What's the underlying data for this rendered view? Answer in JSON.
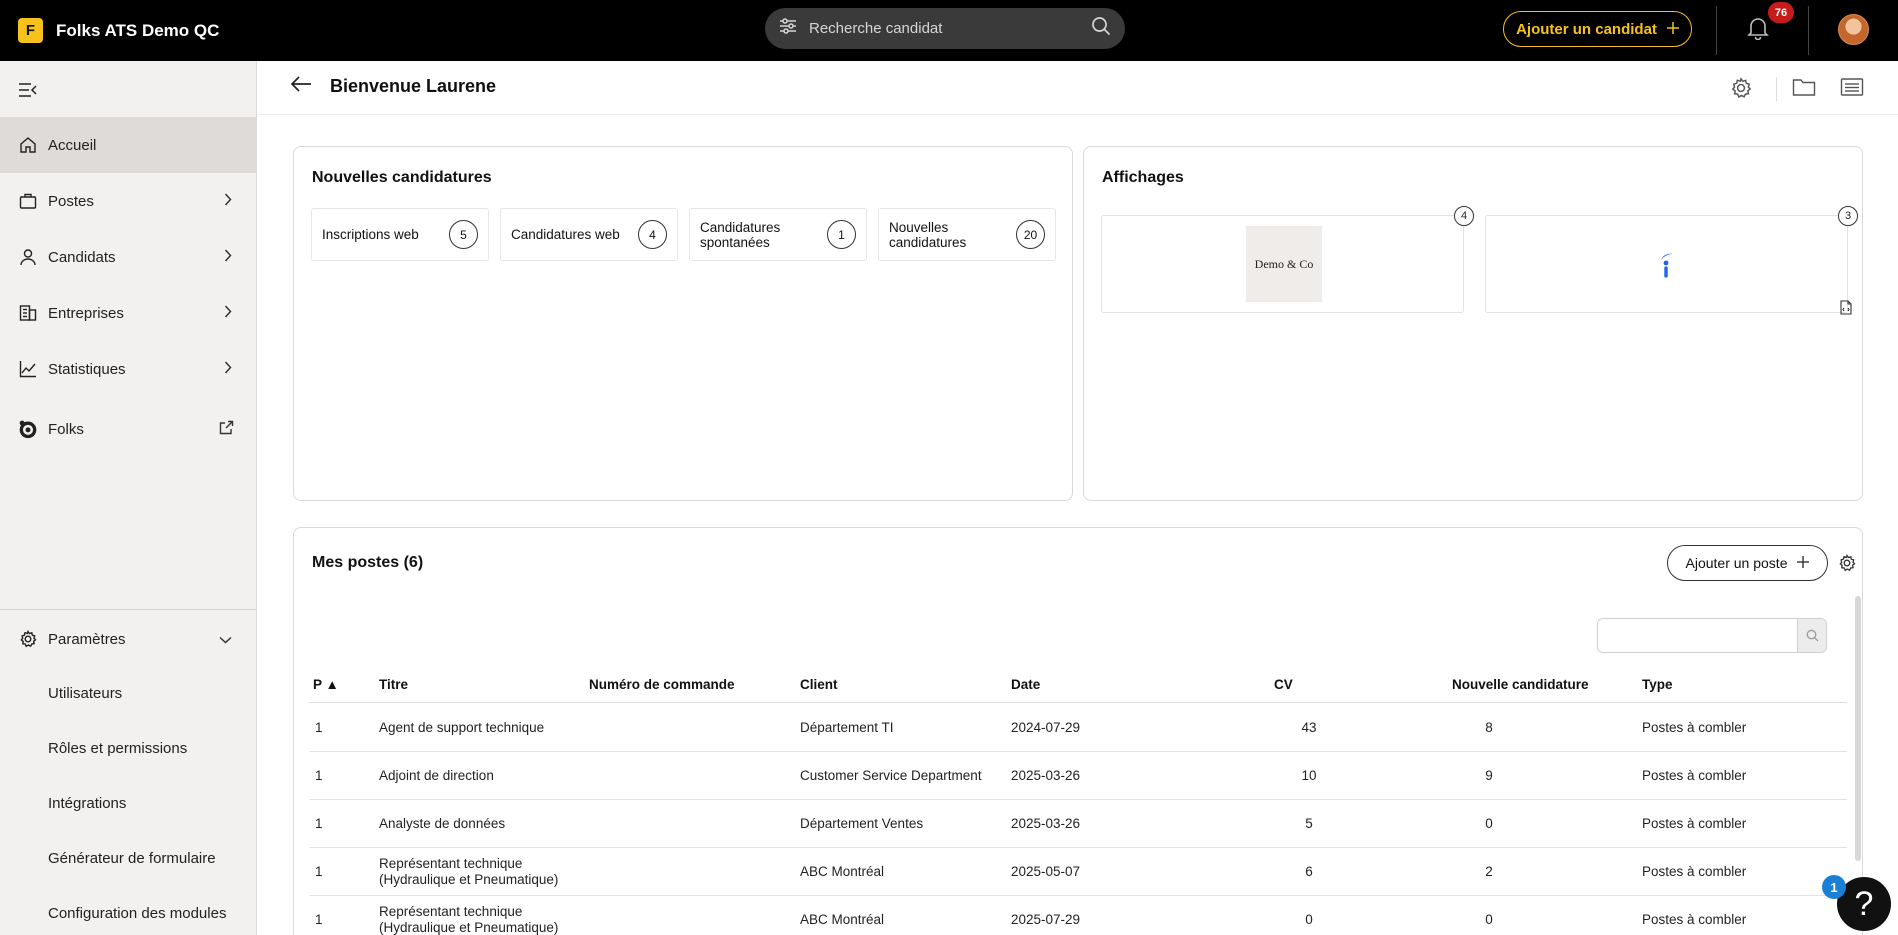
{
  "brand": {
    "logo_letter": "F",
    "name": "Folks ATS Demo QC"
  },
  "search": {
    "placeholder": "Recherche candidat"
  },
  "header_actions": {
    "add_candidate": "Ajouter un candidat",
    "notification_count": "76"
  },
  "sidebar": {
    "items": [
      {
        "label": "Accueil",
        "icon": "home-icon",
        "active": true
      },
      {
        "label": "Postes",
        "icon": "briefcase-icon"
      },
      {
        "label": "Candidats",
        "icon": "user-icon"
      },
      {
        "label": "Entreprises",
        "icon": "building-icon"
      },
      {
        "label": "Statistiques",
        "icon": "chart-icon"
      },
      {
        "label": "Folks",
        "icon": "folks-icon"
      }
    ],
    "settings": {
      "label": "Paramètres",
      "sub_items": [
        "Utilisateurs",
        "Rôles et permissions",
        "Intégrations",
        "Générateur de formulaire",
        "Configuration des modules"
      ]
    }
  },
  "page": {
    "title": "Bienvenue Laurene"
  },
  "new_applications": {
    "title": "Nouvelles candidatures",
    "stats": [
      {
        "label": "Inscriptions web",
        "count": "5"
      },
      {
        "label": "Candidatures web",
        "count": "4"
      },
      {
        "label": "Candidatures spontanées",
        "count": "1"
      },
      {
        "label": "Nouvelles candidatures",
        "count": "20"
      }
    ]
  },
  "postings": {
    "title": "Affichages",
    "boards": [
      {
        "name": "Demo & Co",
        "count": "4"
      },
      {
        "name": "indeed-logo",
        "count": "3"
      }
    ]
  },
  "my_posts": {
    "title": "Mes postes (6)",
    "add_label": "Ajouter un poste",
    "columns": [
      "P ▲",
      "Titre",
      "Numéro de commande",
      "Client",
      "Date",
      "CV",
      "Nouvelle candidature",
      "Type"
    ],
    "rows": [
      [
        "1",
        "Agent de support technique",
        "",
        "Département TI",
        "2024-07-29",
        "43",
        "8",
        "Postes à combler"
      ],
      [
        "1",
        "Adjoint de direction",
        "",
        "Customer Service Department",
        "2025-03-26",
        "10",
        "9",
        "Postes à combler"
      ],
      [
        "1",
        "Analyste de données",
        "",
        "Département Ventes",
        "2025-03-26",
        "5",
        "0",
        "Postes à combler"
      ],
      [
        "1",
        "Représentant technique (Hydraulique et Pneumatique)",
        "",
        "ABC Montréal",
        "2025-05-07",
        "6",
        "2",
        "Postes à combler"
      ],
      [
        "1",
        "Représentant technique (Hydraulique et Pneumatique)",
        "",
        "ABC Montréal",
        "2025-07-29",
        "0",
        "0",
        "Postes à combler"
      ]
    ]
  },
  "help": {
    "badge": "1",
    "glyph": "?"
  },
  "colors": {
    "accent": "#f6c21b",
    "topbar": "#000000",
    "badge": "#c61b1b",
    "help_badge": "#1b7fd6"
  }
}
